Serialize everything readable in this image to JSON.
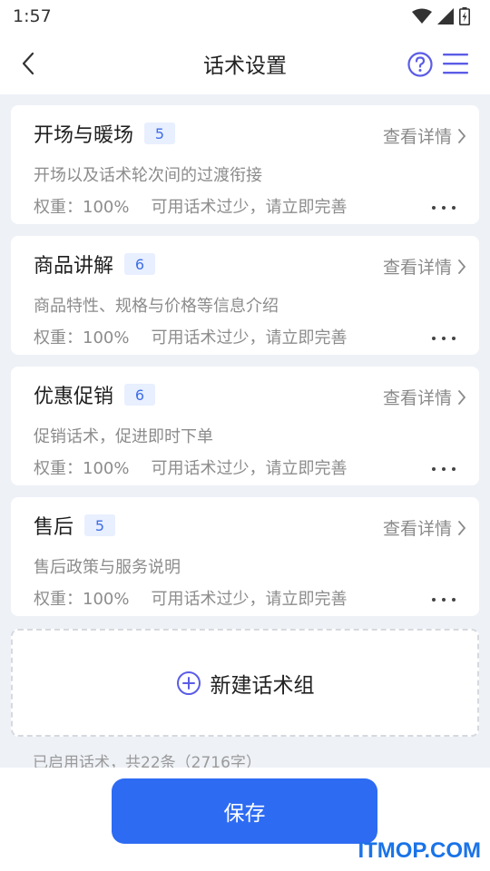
{
  "status_bar": {
    "time": "1:57",
    "icons": [
      "wifi-icon",
      "signal-icon",
      "battery-icon"
    ]
  },
  "header": {
    "title": "话术设置",
    "back_icon": "chevron-left-icon",
    "help_icon": "question-circle-icon",
    "menu_icon": "hamburger-menu-icon"
  },
  "groups": [
    {
      "title": "开场与暖场",
      "count": "5",
      "detail_label": "查看详情",
      "description": "开场以及话术轮次间的过渡衔接",
      "weight": "权重：100%",
      "warning": "可用话术过少，请立即完善"
    },
    {
      "title": "商品讲解",
      "count": "6",
      "detail_label": "查看详情",
      "description": "商品特性、规格与价格等信息介绍",
      "weight": "权重：100%",
      "warning": "可用话术过少，请立即完善"
    },
    {
      "title": "优惠促销",
      "count": "6",
      "detail_label": "查看详情",
      "description": "促销话术，促进即时下单",
      "weight": "权重：100%",
      "warning": "可用话术过少，请立即完善"
    },
    {
      "title": "售后",
      "count": "5",
      "detail_label": "查看详情",
      "description": "售后政策与服务说明",
      "weight": "权重：100%",
      "warning": "可用话术过少，请立即完善"
    }
  ],
  "add_group": {
    "label": "新建话术组",
    "icon": "plus-circle-icon"
  },
  "summary": "已启用话术，共22条（2716字）",
  "footer": {
    "save_label": "保存"
  },
  "watermark": "ITMOP.COM",
  "colors": {
    "accent": "#2d6bf3",
    "badge_bg": "#e8efff",
    "badge_text": "#3f6fe6",
    "icon_purple": "#5b5ce6"
  }
}
